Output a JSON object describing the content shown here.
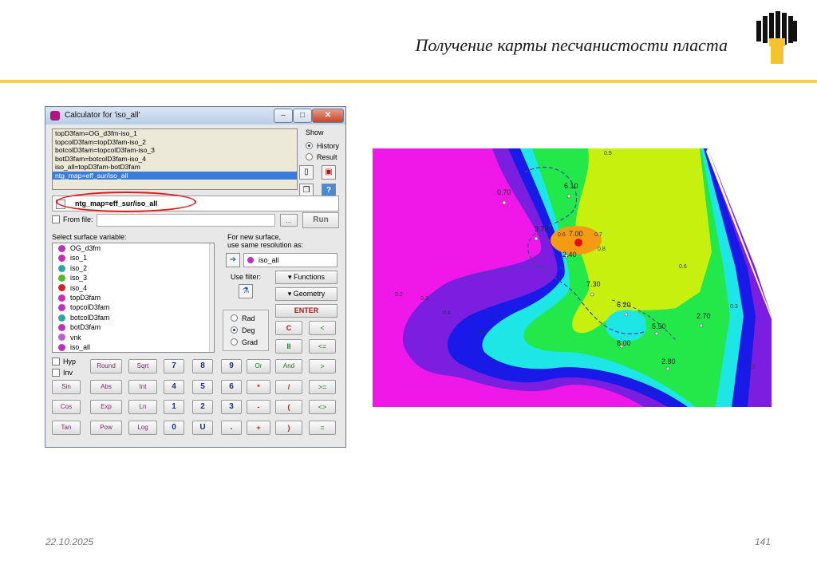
{
  "slide": {
    "title": "Получение карты песчанистости пласта",
    "date": "22.10.2025",
    "page": "141"
  },
  "calculator": {
    "window_title": "Calculator for 'iso_all'",
    "history": [
      "topD3fam=OG_d3fm-iso_1",
      "topcolD3fam=topD3fam-iso_2",
      "botcolD3fam=topcolD3fam-iso_3",
      "botD3fam=botcolD3fam-iso_4",
      "iso_all=topD3fam-botD3fam",
      "ntg_map=eff_sur/iso_all"
    ],
    "show_label": "Show",
    "show_history": "History",
    "show_result": "Result",
    "expression": "ntg_map=eff_sur/iso_all",
    "from_file_label": "From file:",
    "browse_label": "...",
    "run_label": "Run",
    "select_var_label": "Select surface variable:",
    "variables": [
      "OG_d3fm",
      "iso_1",
      "iso_2",
      "iso_3",
      "iso_4",
      "topD3fam",
      "topcolD3fam",
      "botcolD3fam",
      "botD3fam",
      "vnk",
      "iso_all"
    ],
    "new_surface_label_1": "For new surface,",
    "new_surface_label_2": "use same resolution as:",
    "resolution_value": "iso_all",
    "use_filter_label": "Use filter:",
    "functions_label": "Functions",
    "geometry_label": "Geometry",
    "enter_label": "ENTER",
    "c_label": "C",
    "less_label": "<",
    "ii_label": "II",
    "le_label": "<=",
    "rad_label": "Rad",
    "deg_label": "Deg",
    "grad_label": "Grad",
    "hyp_label": "Hyp",
    "inv_label": "Inv",
    "fn_row1": [
      "Round",
      "Sqrt"
    ],
    "fn_row2": [
      "Sin",
      "Abs",
      "Int"
    ],
    "fn_row3": [
      "Cos",
      "Exp",
      "Ln"
    ],
    "fn_row4": [
      "Tan",
      "Pow",
      "Log"
    ],
    "num_row1": [
      "7",
      "8",
      "9"
    ],
    "num_row2": [
      "4",
      "5",
      "6"
    ],
    "num_row3": [
      "1",
      "2",
      "3"
    ],
    "num_row4": [
      "0",
      "U",
      "."
    ],
    "logic_row1": [
      "Or",
      "And",
      ">"
    ],
    "op_row2": [
      "*",
      "/",
      ">="
    ],
    "op_row3": [
      "-",
      "(",
      "<>"
    ],
    "op_row4": [
      "+",
      ")",
      "="
    ]
  },
  "map": {
    "labels": [
      "0.70",
      "6.10",
      "3.70",
      "7.00",
      "2.40",
      "7.30",
      "6.20",
      "5.50",
      "2.70",
      "8.00",
      "2.80"
    ],
    "contour_labels": [
      "0.2",
      "0.3",
      "0.4",
      "0.5",
      "0.6",
      "0.8",
      "0.7",
      "0.6",
      "0.3",
      "0.2",
      "0.4",
      "0.5"
    ]
  },
  "colors": {
    "accent_line": "#f4d24a",
    "annotation": "#e0191a",
    "selection": "#3a7bdc"
  },
  "icons": [
    "company-logo-icon",
    "calculator-icon",
    "minimize-icon",
    "maximize-icon",
    "close-icon",
    "new-doc-icon",
    "copy-icon",
    "help-icon",
    "filter-icon",
    "arrow-right-icon",
    "surface-icon"
  ]
}
